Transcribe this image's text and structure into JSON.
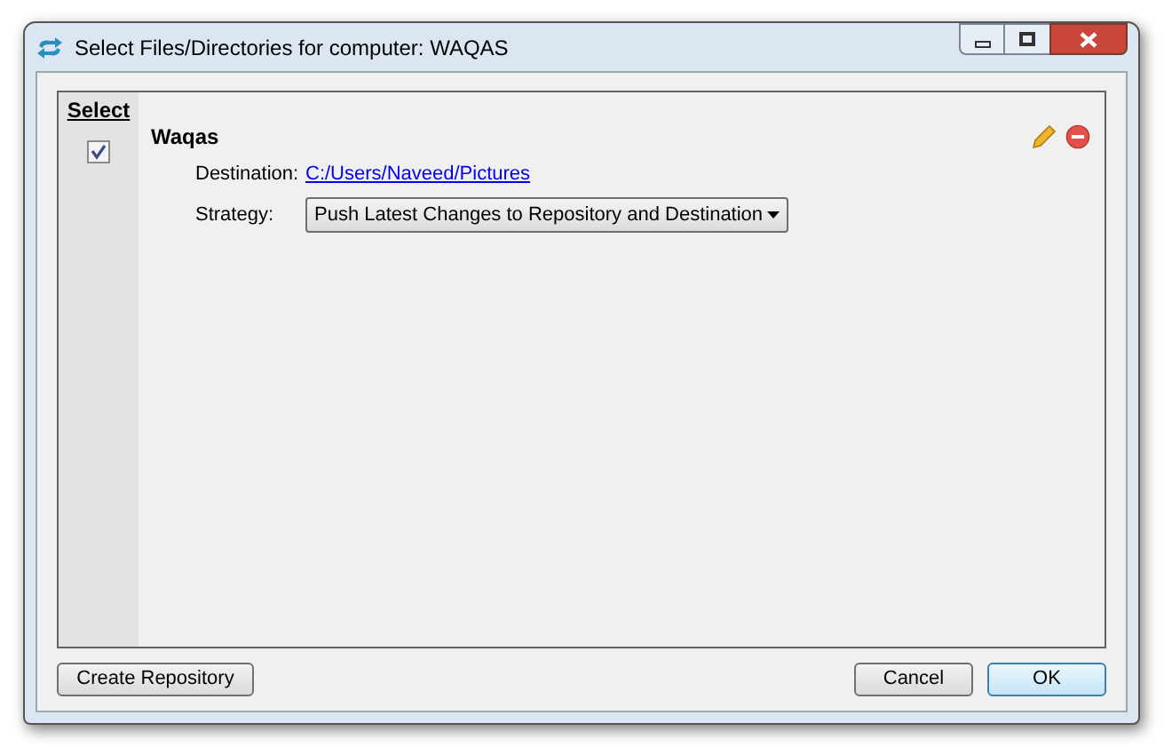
{
  "window": {
    "title": "Select Files/Directories for computer: WAQAS"
  },
  "list": {
    "column_header": "Select",
    "items": [
      {
        "name": "Waqas",
        "checked": true,
        "destination_label": "Destination:",
        "destination": "C:/Users/Naveed/Pictures",
        "strategy_label": "Strategy:",
        "strategy": "Push Latest Changes to Repository and Destination"
      }
    ]
  },
  "buttons": {
    "left": "Create Repository",
    "cancel": "Cancel",
    "ok": "OK"
  }
}
